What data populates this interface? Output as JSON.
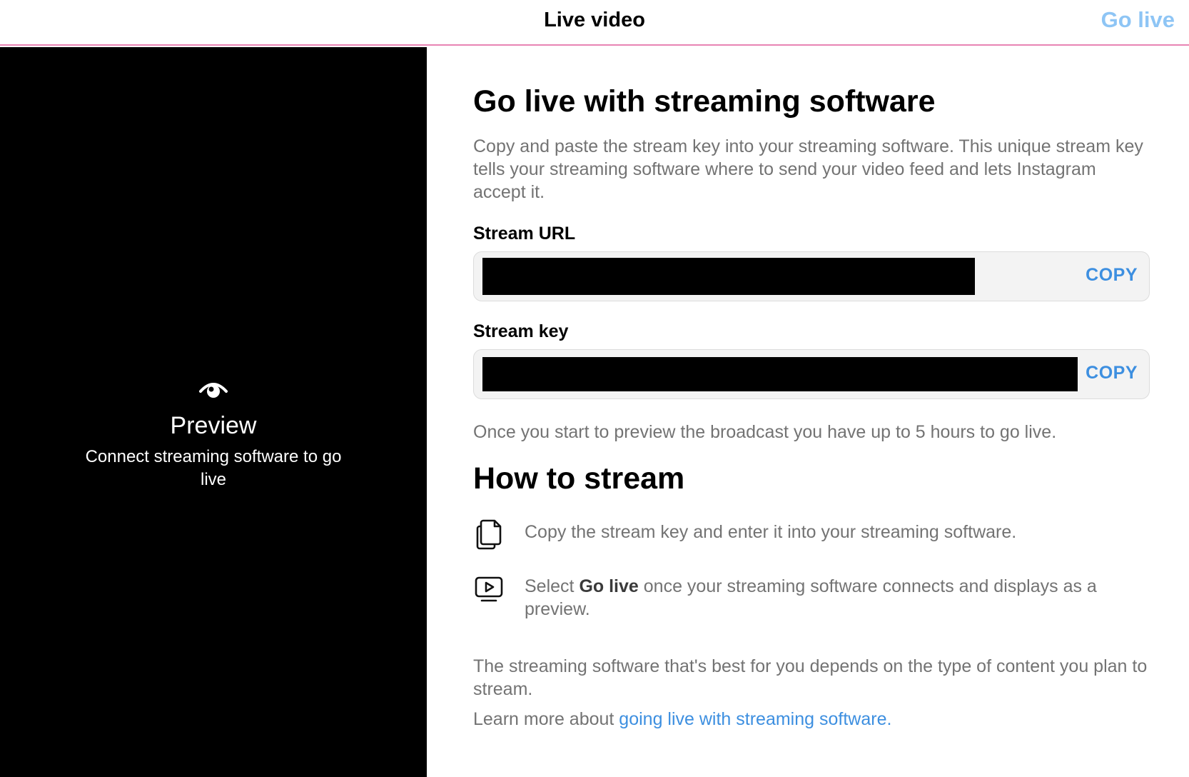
{
  "header": {
    "title": "Live video",
    "go_live_label": "Go live"
  },
  "preview": {
    "icon": "eye-icon",
    "title": "Preview",
    "subtitle": "Connect streaming software to go live"
  },
  "main": {
    "heading": "Go live with streaming software",
    "description": "Copy and paste the stream key into your streaming software. This unique stream key tells your streaming software where to send your video feed and lets Instagram accept it.",
    "stream_url": {
      "label": "Stream URL",
      "copy_label": "COPY"
    },
    "stream_key": {
      "label": "Stream key",
      "copy_label": "COPY"
    },
    "preview_note": "Once you start to preview the broadcast you have up to 5 hours to go live."
  },
  "how_to": {
    "heading": "How to stream",
    "steps": [
      {
        "icon": "copy-documents-icon",
        "text": "Copy the stream key and enter it into your streaming software."
      },
      {
        "icon": "play-screen-icon",
        "text_before": "Select ",
        "text_bold": "Go live",
        "text_after": " once your streaming software connects and displays as a preview."
      }
    ],
    "best_software": "The streaming software that's best for you depends on the type of content you plan to stream.",
    "learn_prefix": "Learn more about ",
    "learn_link": "going live with streaming software."
  },
  "colors": {
    "accent_link": "#3d8fe0",
    "go_live_disabled": "#8ec5f5",
    "header_border": "#e884b4",
    "muted_text": "#737373"
  }
}
